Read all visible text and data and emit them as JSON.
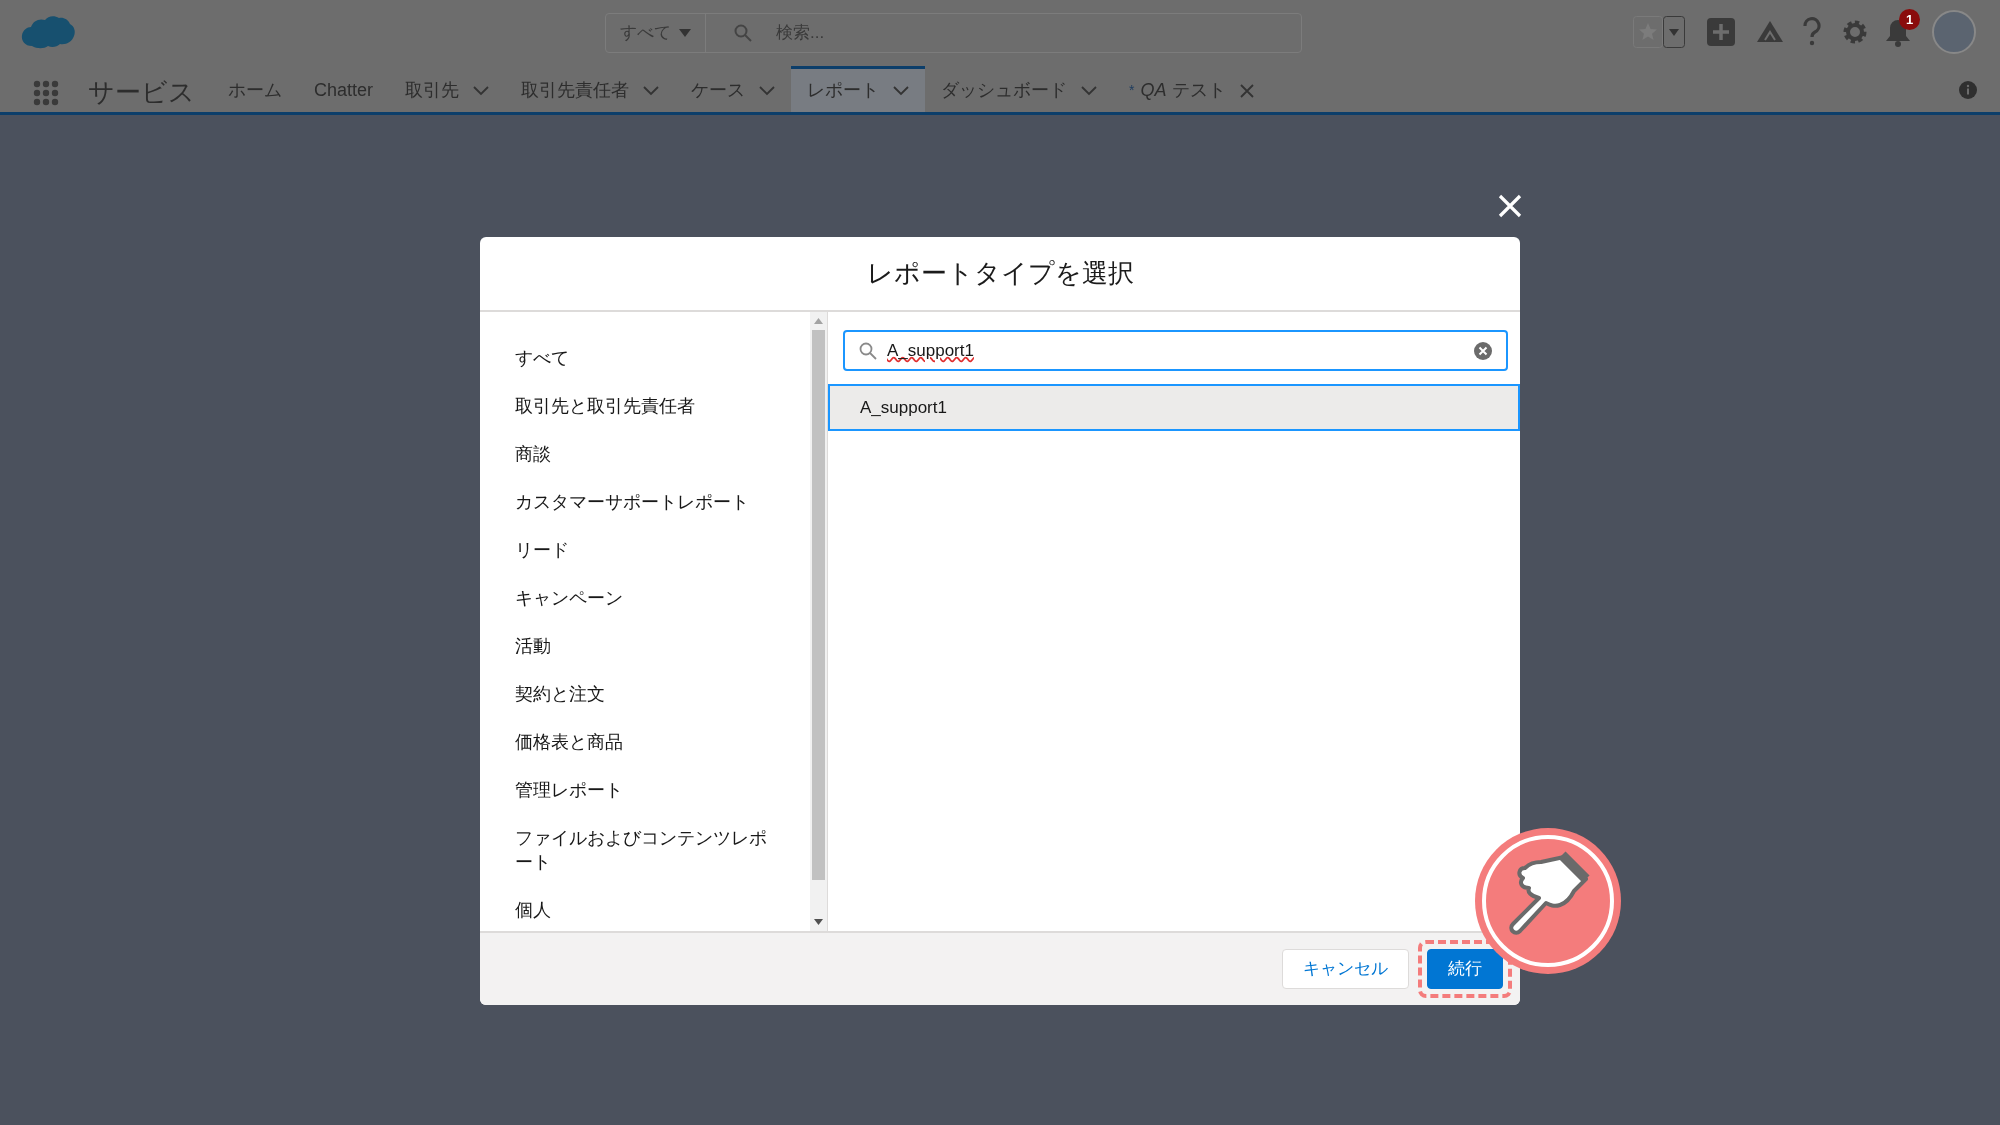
{
  "header": {
    "search": {
      "scope": "すべて",
      "placeholder": "検索..."
    },
    "notification_count": "1",
    "app_name": "サービス",
    "nav_tabs": [
      {
        "label": "ホーム",
        "kind": "plain",
        "selected": false
      },
      {
        "label": "Chatter",
        "kind": "plain",
        "selected": false
      },
      {
        "label": "取引先",
        "kind": "menu",
        "selected": false
      },
      {
        "label": "取引先責任者",
        "kind": "menu",
        "selected": false
      },
      {
        "label": "ケース",
        "kind": "menu",
        "selected": false
      },
      {
        "label": "レポート",
        "kind": "menu",
        "selected": true
      },
      {
        "label": "ダッシュボード",
        "kind": "menu",
        "selected": false
      },
      {
        "marker": "*",
        "label": "*QA* テスト",
        "kind": "closable",
        "selected": false
      }
    ]
  },
  "modal": {
    "title": "レポートタイプを選択",
    "categories": [
      "すべて",
      "取引先と取引先責任者",
      "商談",
      "カスタマーサポートレポート",
      "リード",
      "キャンペーン",
      "活動",
      "契約と注文",
      "価格表と商品",
      "管理レポート",
      "ファイルおよびコンテンツレポート",
      "個人"
    ],
    "search": {
      "value": "A_support1"
    },
    "results": [
      {
        "label": "A_support1",
        "selected": true
      }
    ],
    "buttons": [
      {
        "label": "キャンセル",
        "kind": "neutral",
        "highlighted": false
      },
      {
        "label": "続行",
        "kind": "brand",
        "highlighted": true
      }
    ]
  }
}
